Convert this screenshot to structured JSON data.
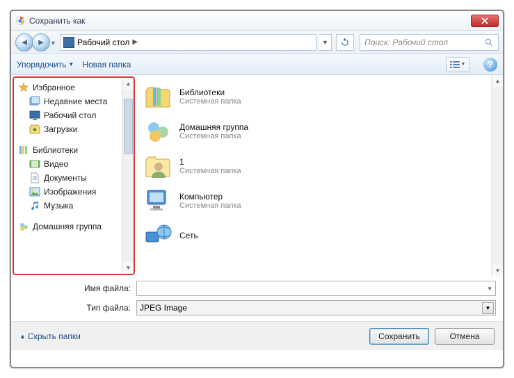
{
  "window": {
    "title": "Сохранить как"
  },
  "nav": {
    "location": "Рабочий стол",
    "search_placeholder": "Поиск: Рабочий стол"
  },
  "toolbar": {
    "organize": "Упорядочить",
    "new_folder": "Новая папка"
  },
  "sidebar": {
    "favorites": {
      "label": "Избранное",
      "items": [
        {
          "label": "Недавние места"
        },
        {
          "label": "Рабочий стол"
        },
        {
          "label": "Загрузки"
        }
      ]
    },
    "libraries": {
      "label": "Библиотеки",
      "items": [
        {
          "label": "Видео"
        },
        {
          "label": "Документы"
        },
        {
          "label": "Изображения"
        },
        {
          "label": "Музыка"
        }
      ]
    },
    "homegroup": {
      "label": "Домашняя группа"
    }
  },
  "items": [
    {
      "name": "Библиотеки",
      "desc": "Системная папка"
    },
    {
      "name": "Домашняя группа",
      "desc": "Системная папка"
    },
    {
      "name": "1",
      "desc": "Системная папка"
    },
    {
      "name": "Компьютер",
      "desc": "Системная папка"
    },
    {
      "name": "Сеть",
      "desc": ""
    }
  ],
  "form": {
    "filename_label": "Имя файла:",
    "filename_value": "",
    "filetype_label": "Тип файла:",
    "filetype_value": "JPEG Image"
  },
  "footer": {
    "hide_folders": "Скрыть папки",
    "save": "Сохранить",
    "cancel": "Отмена"
  }
}
